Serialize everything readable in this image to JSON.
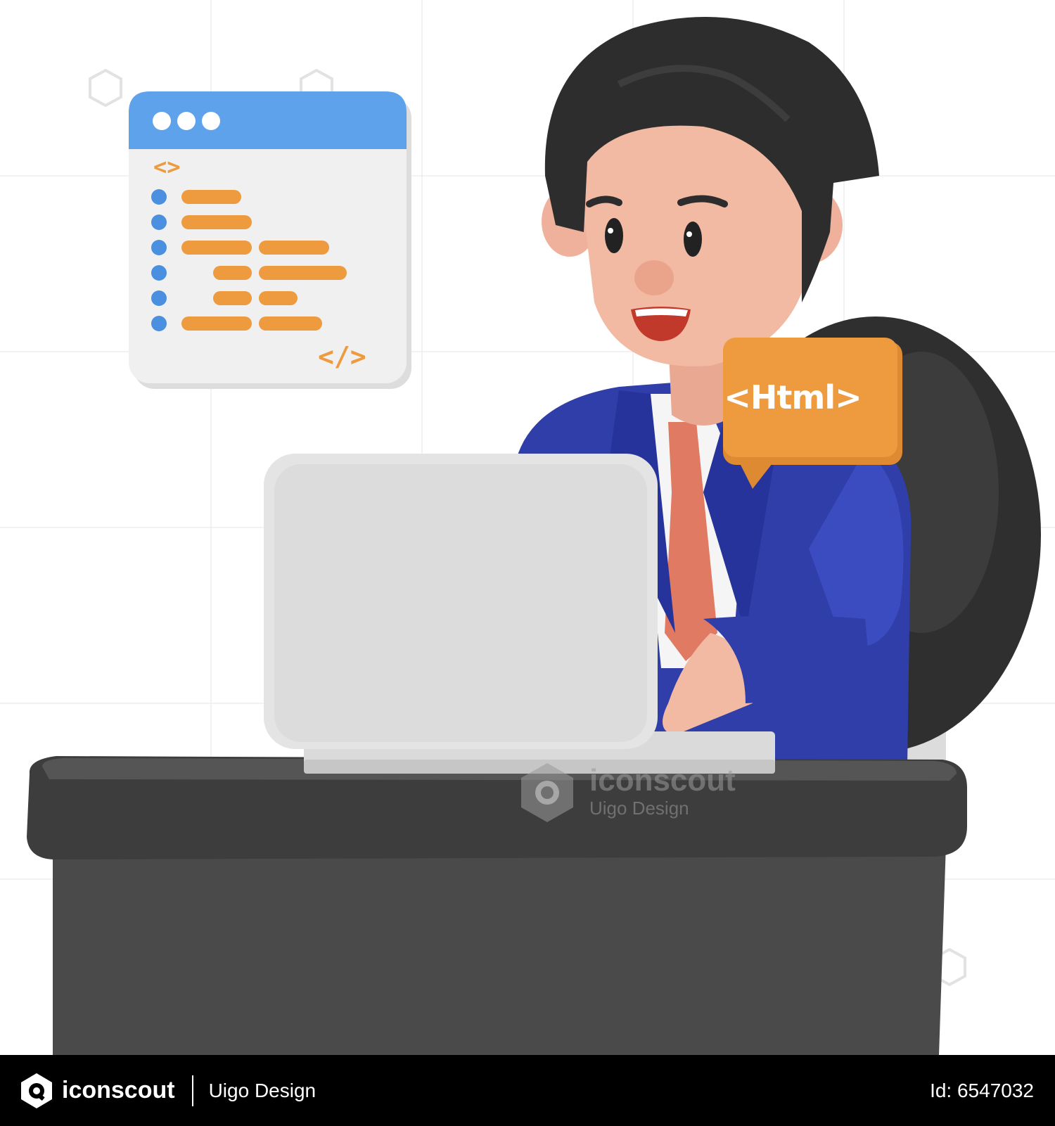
{
  "speech_bubble": {
    "label": "<Html>"
  },
  "code_window": {
    "open_tag": "<>",
    "close_tag": "</>"
  },
  "watermark": {
    "brand": "iconscout",
    "author": "Uigo Design"
  },
  "footer": {
    "brand": "iconscout",
    "author": "Uigo Design",
    "asset_id": "Id: 6547032"
  },
  "colors": {
    "suit": "#2f3ea8",
    "tie": "#e07a62",
    "hair": "#2d2d2d",
    "skin": "#f2b9a3",
    "desk": "#4a4a4a",
    "chair": "#2f2f2f",
    "accent_orange": "#ee9a3e",
    "window_blue": "#5fa2ec"
  },
  "icons": [
    "code-window-icon",
    "speech-bubble-icon",
    "iconscout-logo-icon"
  ]
}
